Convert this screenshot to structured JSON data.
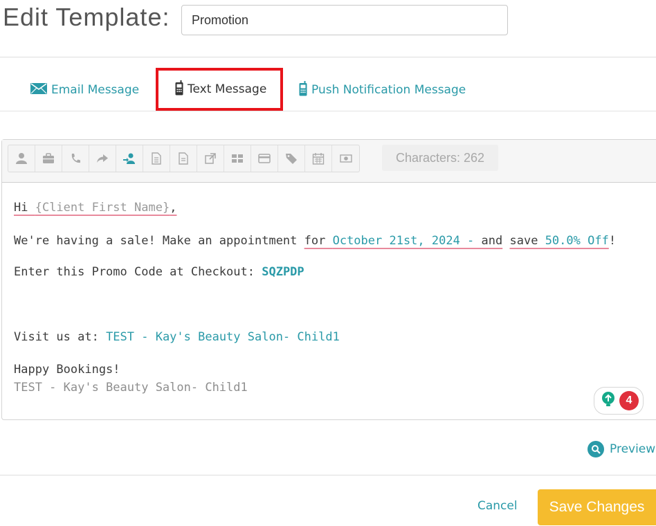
{
  "header": {
    "title": "Edit Template:",
    "template_name": "Promotion"
  },
  "tabs": [
    {
      "label": "Email Message",
      "icon": "envelope-icon"
    },
    {
      "label": "Text Message",
      "icon": "mobile-phone-icon",
      "active": true
    },
    {
      "label": "Push Notification Message",
      "icon": "mobile-phone-icon"
    }
  ],
  "toolbar": {
    "buttons": [
      "user-icon",
      "briefcase-icon",
      "phone-icon",
      "share-arrow-icon",
      "assign-user-icon",
      "document-icon",
      "document-lines-icon",
      "external-link-icon",
      "grid-icon",
      "credit-card-icon",
      "tag-icon",
      "calendar-icon",
      "cash-icon"
    ],
    "characters": "Characters: 262"
  },
  "message": {
    "line1": {
      "greeting": "Hi ",
      "placeholder": "{Client First Name}",
      "comma": ","
    },
    "line2": {
      "text": "We're having a sale! Make an appointment ",
      "for": "for ",
      "date": "October 21st, 2024 - ",
      "and": " and",
      "space": " ",
      "save": "save",
      "discount": " 50.0% Off",
      "bang": "!"
    },
    "line3": {
      "text": "Enter this Promo Code at Checkout: ",
      "code": "SQZPDP"
    },
    "line4": {
      "text": "Visit us at: ",
      "business": "TEST - Kay's Beauty Salon- Child1"
    },
    "line5": {
      "text": "Happy Bookings!"
    },
    "line6": {
      "business": "TEST - Kay's Beauty Salon- Child1"
    }
  },
  "grammar_widget": {
    "count": "4"
  },
  "actions": {
    "preview": "Preview",
    "cancel": "Cancel",
    "save": "Save Changes"
  },
  "colors": {
    "accent": "#2a9aa8",
    "save": "#f5bc2e",
    "highlight_box": "#e8141b"
  }
}
